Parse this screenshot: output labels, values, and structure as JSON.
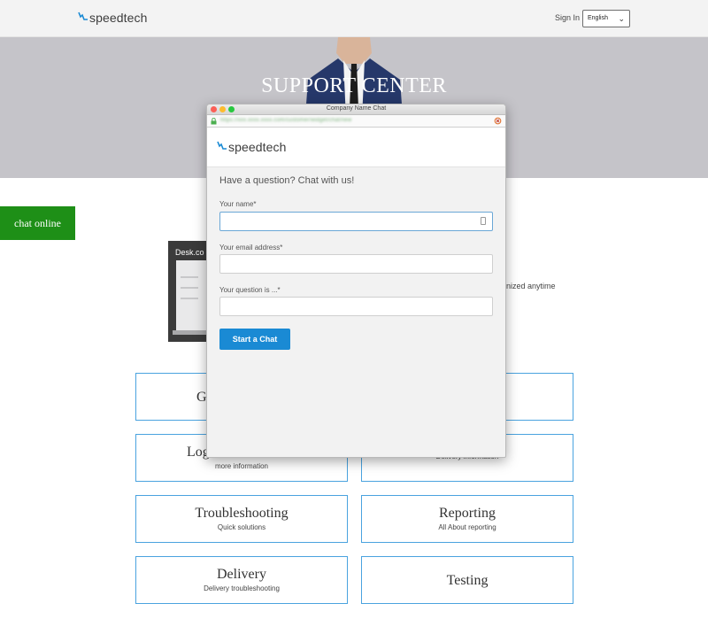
{
  "header": {
    "brand": "speedtech",
    "signin_label": "Sign In",
    "language_selected": "English"
  },
  "hero": {
    "title": "SUPPORT CENTER"
  },
  "chat_tab": {
    "label": "chat online"
  },
  "background": {
    "video_label": "Desk.co",
    "partial_text": "nized anytime"
  },
  "cards": [
    {
      "title": "G",
      "subtitle": ""
    },
    {
      "title": "",
      "subtitle": ""
    },
    {
      "title": "Log",
      "subtitle": "more information"
    },
    {
      "title": "",
      "subtitle": "Delivery information"
    },
    {
      "title": "Troubleshooting",
      "subtitle": "Quick solutions"
    },
    {
      "title": "Reporting",
      "subtitle": "All About reporting"
    },
    {
      "title": "Delivery",
      "subtitle": "Delivery troubleshooting"
    },
    {
      "title": "Testing",
      "subtitle": ""
    }
  ],
  "chat_window": {
    "window_title": "Company Name Chat",
    "brand": "speedtech",
    "heading": "Have a question? Chat with us!",
    "fields": [
      {
        "label": "Your name*",
        "value": ""
      },
      {
        "label": "Your email address*",
        "value": ""
      },
      {
        "label": "Your question is ...*",
        "value": ""
      }
    ],
    "submit_label": "Start a Chat"
  },
  "colors": {
    "accent": "#1a8ad4",
    "chat_tab": "#1e8f17",
    "card_border": "#4aa3df",
    "hero_bg": "#c5c4c9"
  }
}
